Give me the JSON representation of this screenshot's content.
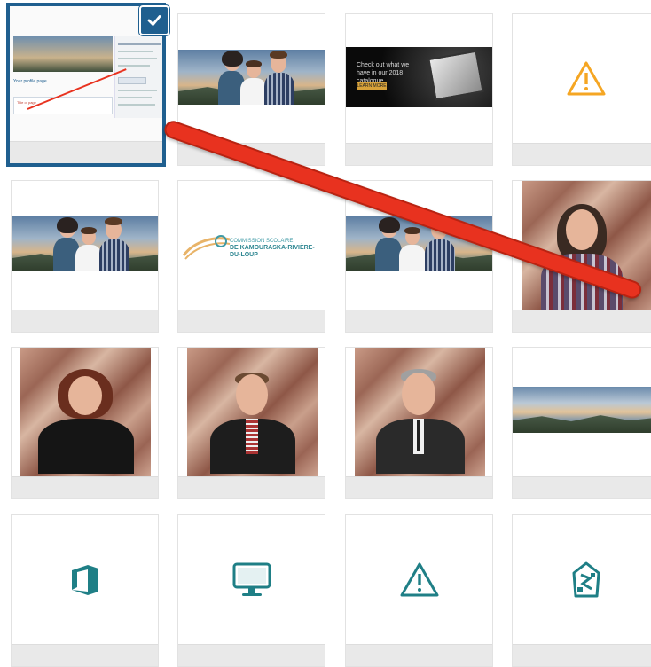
{
  "grid": {
    "tiles": [
      {
        "name": "tile-screenshot",
        "kind": "screenshot",
        "selected": true,
        "mini_title": "Your profile page",
        "mini_field": "Title of page"
      },
      {
        "name": "tile-banner-family",
        "kind": "banner"
      },
      {
        "name": "tile-ad-catalogue",
        "kind": "ad",
        "ad_text": "Check out what we have in our 2018 catalogue",
        "ad_button": "LEARN MORE"
      },
      {
        "name": "tile-warning-1",
        "kind": "warning",
        "icon": "warning-icon",
        "icon_color": "#f5a623"
      },
      {
        "name": "tile-banner-family-2",
        "kind": "banner"
      },
      {
        "name": "tile-logo-commission",
        "kind": "logo",
        "logo_line1": "COMMISSION SCOLAIRE",
        "logo_line2": "DE KAMOURASKA-RIVIÈRE-DU-LOUP"
      },
      {
        "name": "tile-banner-family-3",
        "kind": "banner"
      },
      {
        "name": "tile-portrait-woman-1",
        "kind": "portrait"
      },
      {
        "name": "tile-portrait-woman-2",
        "kind": "portrait"
      },
      {
        "name": "tile-portrait-man-1",
        "kind": "portrait"
      },
      {
        "name": "tile-portrait-man-2",
        "kind": "portrait"
      },
      {
        "name": "tile-landscape",
        "kind": "landscape"
      },
      {
        "name": "tile-office-icon",
        "kind": "icon",
        "icon": "office-icon",
        "icon_color": "#1f7f86"
      },
      {
        "name": "tile-monitor-icon",
        "kind": "icon",
        "icon": "monitor-icon",
        "icon_color": "#1f7f86"
      },
      {
        "name": "tile-warning-2",
        "kind": "icon",
        "icon": "warning-icon",
        "icon_color": "#1f7f86"
      },
      {
        "name": "tile-house-icon",
        "kind": "icon",
        "icon": "broken-house-icon",
        "icon_color": "#1f7f86"
      }
    ]
  },
  "annotation": {
    "arrow": "red-arrow",
    "color": "#e8321f"
  },
  "colors": {
    "selection": "#1f5f8f",
    "accent_teal": "#1f7f86",
    "warning_orange": "#f5a623"
  }
}
